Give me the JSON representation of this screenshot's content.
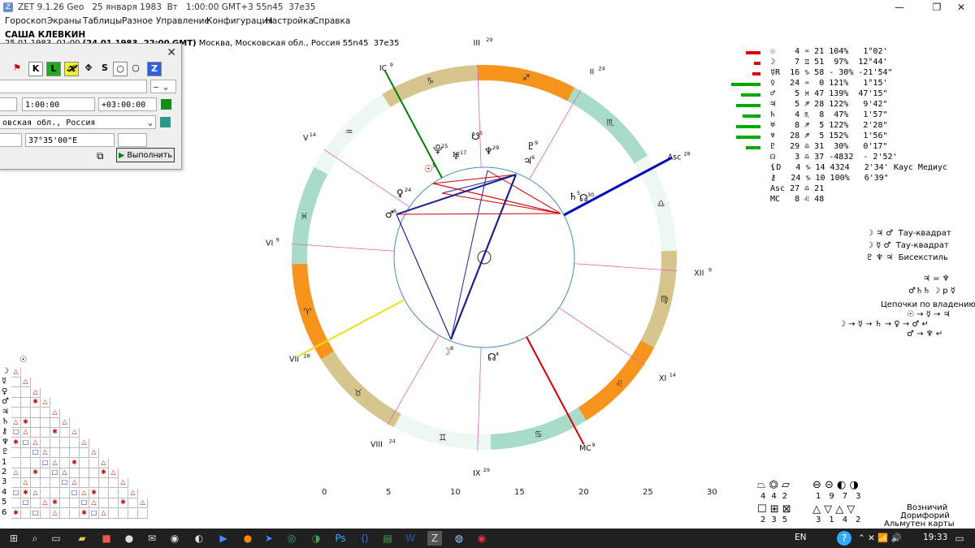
{
  "window": {
    "title": "ZET 9.1.26 Geo   25 января 1983  Вт   1:00:00 GMT+3 55n45  37e35",
    "minimize": "—",
    "maximize": "❐",
    "close": "✕"
  },
  "menu": [
    "Гороскоп",
    "Экраны",
    "Таблицы",
    "Разное",
    "Управление",
    "Конфигурация",
    "Настройка",
    "Справка"
  ],
  "person": "САША КЛЕВКИН",
  "chart_info_pre": "25.01.1983  01:00 ",
  "chart_info_bold": "(24.01.1983, 22:00 GMT)",
  "chart_info_post": " Москва, Московская обл., Россия 55n45  37e35",
  "dialog": {
    "close": "✕",
    "toolbar": [
      "K",
      "L",
      "𝓗",
      "⯑",
      "S",
      "○",
      "○",
      "Z"
    ],
    "dropdown_value": "–",
    "time": "1:00:00",
    "tz": "+03:00:00",
    "place": "овская обл., Россия",
    "longitude": "37°35'00\"E",
    "run": "Выполнить"
  },
  "wheel": {
    "cusps": [
      {
        "label": "III",
        "sup": "29"
      },
      {
        "label": "II",
        "sup": "24"
      },
      {
        "label": "Asc",
        "sup": "28"
      },
      {
        "label": "XII",
        "sup": "9"
      },
      {
        "label": "XI",
        "sup": "14"
      },
      {
        "label": "MC",
        "sup": "9"
      },
      {
        "label": "IX",
        "sup": "29"
      },
      {
        "label": "VIII",
        "sup": "24"
      },
      {
        "label": "VII",
        "sup": "28"
      },
      {
        "label": "VI",
        "sup": "9"
      },
      {
        "label": "V",
        "sup": "14"
      },
      {
        "label": "IC",
        "sup": "9"
      }
    ],
    "signs": [
      "♐",
      "♏",
      "♎",
      "♍",
      "♌",
      "♋",
      "♊",
      "♉",
      "♈",
      "♓",
      "♒",
      "♑"
    ],
    "planets_labels": [
      {
        "g": "☉",
        "sup": "5",
        "color": "#d00000"
      },
      {
        "g": "♀",
        "sup": "24",
        "color": "#000"
      },
      {
        "g": "♂",
        "sup": "6",
        "color": "#000"
      },
      {
        "g": "⯓",
        "sup": "25",
        "color": "#000"
      },
      {
        "g": "♅",
        "sup": "17",
        "color": "#000"
      },
      {
        "g": "♆",
        "sup": "29",
        "color": "#000"
      },
      {
        "g": "☋",
        "sup": "5",
        "color": "#000"
      },
      {
        "g": "♇",
        "sup": "9",
        "color": "#000"
      },
      {
        "g": "♃",
        "sup": "6",
        "color": "#000"
      },
      {
        "g": "♄",
        "sup": "5",
        "color": "#000"
      },
      {
        "g": "☊",
        "sup": "30",
        "color": "#000"
      },
      {
        "g": "☽",
        "sup": "8",
        "color": "#d00000"
      },
      {
        "g": "☊",
        "sup": "4",
        "color": "#000"
      }
    ]
  },
  "positions": [
    {
      "g": "☉",
      "deg": " 4",
      "sign": "♒",
      "min": "21",
      "pct": " 104%",
      "speed": "  1°02'"
    },
    {
      "g": "☽",
      "deg": " 7",
      "sign": "♊",
      "min": "51",
      "pct": "  97%",
      "speed": " 12°44'"
    },
    {
      "g": "☿R",
      "deg": "16",
      "sign": "♑",
      "min": "58",
      "pct": " - 30%",
      "speed": "-21'54\""
    },
    {
      "g": "♀",
      "deg": "24",
      "sign": "♒",
      "min": " 0",
      "pct": " 121%",
      "speed": "  1°15'"
    },
    {
      "g": "♂",
      "deg": " 5",
      "sign": "♓",
      "min": "47",
      "pct": " 139%",
      "speed": " 47'15\""
    },
    {
      "g": "♃",
      "deg": " 5",
      "sign": "♐",
      "min": "28",
      "pct": " 122%",
      "speed": "  9'42\""
    },
    {
      "g": "♄",
      "deg": " 4",
      "sign": "♏",
      "min": " 8",
      "pct": "  47%",
      "speed": "  1'57\""
    },
    {
      "g": "♅",
      "deg": " 8",
      "sign": "♐",
      "min": " 5",
      "pct": " 122%",
      "speed": "  2'28\""
    },
    {
      "g": "♆",
      "deg": "28",
      "sign": "♐",
      "min": " 5",
      "pct": " 152%",
      "speed": "  1'56\""
    },
    {
      "g": "♇",
      "deg": "29",
      "sign": "♎",
      "min": "31",
      "pct": "  30%",
      "speed": "  0'17\""
    },
    {
      "g": "☊",
      "deg": " 3",
      "sign": "♎",
      "min": "37",
      "pct": " -4832",
      "speed": " - 2'52'"
    },
    {
      "g": "⚸D",
      "deg": " 4",
      "sign": "♑",
      "min": "14",
      "pct": " 4324",
      "speed": "  2'34' Каус Медиус"
    },
    {
      "g": "⚷",
      "deg": "24",
      "sign": "♑",
      "min": "10",
      "pct": " 100%",
      "speed": "  6'39\""
    },
    {
      "g": "Asc",
      "deg": "27",
      "sign": "♎",
      "min": "21",
      "pct": "",
      "speed": ""
    },
    {
      "g": "MC",
      "deg": " 8",
      "sign": "♌",
      "min": "48",
      "pct": "",
      "speed": ""
    }
  ],
  "configs": [
    {
      "g": "☽ ♃ ♂",
      "text": "Тау-квадрат"
    },
    {
      "g": "☽ ☿ ♂",
      "text": "Тау-квадрат"
    },
    {
      "g": "♇ ♆ ♃",
      "text": "Бисекстиль"
    }
  ],
  "equation": "♃ = ♆",
  "relations": "♂♄♄ ☽ p ☿",
  "chains_title": "Цепочки по владению",
  "chain1": "☉ → ☿ → ♃",
  "chain2": "☽ → ☿ → ♄ → ♀ → ♂ ↵",
  "chain3": "♂ → ♆ ↵",
  "scale_ticks": [
    "0",
    "5",
    "10",
    "15",
    "20",
    "25",
    "30"
  ],
  "bottom_right_sym1": [
    "4",
    "4",
    "2"
  ],
  "bottom_right_sym2": [
    "1",
    "9",
    "7",
    "3"
  ],
  "bottom_right_sym3": [
    "2",
    "3",
    "5"
  ],
  "bottom_right_sym4": [
    "3",
    "1",
    "4",
    "2"
  ],
  "legend": [
    "Возничий",
    "Дорифорий",
    "Альмутен карты"
  ],
  "taskbar": {
    "lang": "EN",
    "time": "19:33"
  },
  "grid_numbers": [
    "1",
    "2",
    "3",
    "4",
    "5",
    "6"
  ]
}
